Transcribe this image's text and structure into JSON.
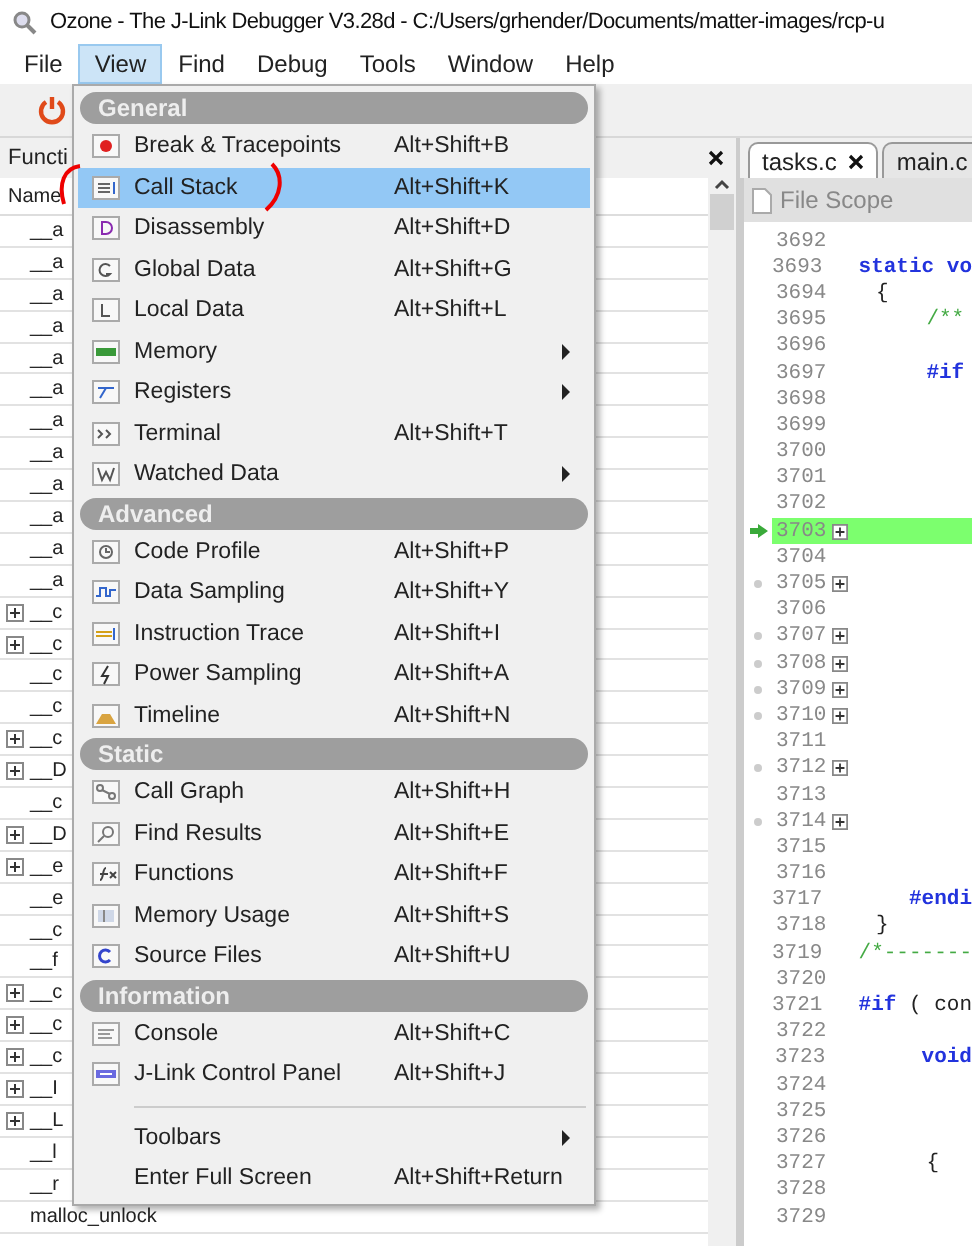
{
  "window": {
    "title": "Ozone - The J-Link Debugger V3.28d - C:/Users/grhender/Documents/matter-images/rcp-u"
  },
  "menubar": [
    {
      "label": "File",
      "selected": false
    },
    {
      "label": "View",
      "selected": true
    },
    {
      "label": "Find",
      "selected": false
    },
    {
      "label": "Debug",
      "selected": false
    },
    {
      "label": "Tools",
      "selected": false
    },
    {
      "label": "Window",
      "selected": false
    },
    {
      "label": "Help",
      "selected": false
    }
  ],
  "functions_panel": {
    "title": "Functi",
    "column": "Name",
    "rows": [
      {
        "name": "__a",
        "expandable": false
      },
      {
        "name": "__a",
        "expandable": false
      },
      {
        "name": "__a",
        "expandable": false
      },
      {
        "name": "__a",
        "expandable": false
      },
      {
        "name": "__a",
        "expandable": false
      },
      {
        "name": "__a",
        "expandable": false
      },
      {
        "name": "__a",
        "expandable": false
      },
      {
        "name": "__a",
        "expandable": false
      },
      {
        "name": "__a",
        "expandable": false
      },
      {
        "name": "__a",
        "expandable": false
      },
      {
        "name": "__a",
        "expandable": false
      },
      {
        "name": "__a",
        "expandable": false
      },
      {
        "name": "__c",
        "expandable": true
      },
      {
        "name": "__c",
        "expandable": true
      },
      {
        "name": "__c",
        "expandable": false
      },
      {
        "name": "__c",
        "expandable": false
      },
      {
        "name": "__c",
        "expandable": true
      },
      {
        "name": "__D",
        "expandable": true
      },
      {
        "name": "__c",
        "expandable": false
      },
      {
        "name": "__D",
        "expandable": true
      },
      {
        "name": "__e",
        "expandable": true
      },
      {
        "name": "__e",
        "expandable": false
      },
      {
        "name": "__c",
        "expandable": false
      },
      {
        "name": "__f",
        "expandable": false
      },
      {
        "name": "__c",
        "expandable": true
      },
      {
        "name": "__c",
        "expandable": true
      },
      {
        "name": "__c",
        "expandable": true
      },
      {
        "name": "__I",
        "expandable": true
      },
      {
        "name": "__L",
        "expandable": true
      },
      {
        "name": "__l",
        "expandable": false
      },
      {
        "name": "__r",
        "expandable": false
      },
      {
        "name": "malloc_unlock",
        "expandable": false
      }
    ]
  },
  "editor": {
    "tabs": [
      {
        "label": "tasks.c",
        "selected": true,
        "closable": true
      },
      {
        "label": "main.c",
        "selected": false,
        "closable": false
      }
    ],
    "scope": "File Scope",
    "lines": [
      {
        "number": "3692"
      },
      {
        "number": "3693",
        "code": [
          {
            "kind": "keyword",
            "text": "static vo"
          }
        ]
      },
      {
        "number": "3694",
        "code": [
          {
            "kind": "plain",
            "text": "{"
          }
        ]
      },
      {
        "number": "3695",
        "code": [
          {
            "kind": "comment",
            "text": "    /**"
          }
        ]
      },
      {
        "number": "3696"
      },
      {
        "number": "3697",
        "code": [
          {
            "kind": "keyword",
            "text": "    #if"
          }
        ]
      },
      {
        "number": "3698"
      },
      {
        "number": "3699"
      },
      {
        "number": "3700"
      },
      {
        "number": "3701"
      },
      {
        "number": "3702"
      },
      {
        "number": "3703",
        "current": true,
        "foldable": true
      },
      {
        "number": "3704"
      },
      {
        "number": "3705",
        "foldable": true,
        "breakpointable": true
      },
      {
        "number": "3706"
      },
      {
        "number": "3707",
        "foldable": true,
        "breakpointable": true
      },
      {
        "number": "3708",
        "foldable": true,
        "breakpointable": true
      },
      {
        "number": "3709",
        "foldable": true,
        "breakpointable": true
      },
      {
        "number": "3710",
        "foldable": true,
        "breakpointable": true
      },
      {
        "number": "3711"
      },
      {
        "number": "3712",
        "foldable": true,
        "breakpointable": true
      },
      {
        "number": "3713"
      },
      {
        "number": "3714",
        "foldable": true,
        "breakpointable": true
      },
      {
        "number": "3715"
      },
      {
        "number": "3716"
      },
      {
        "number": "3717",
        "code": [
          {
            "kind": "keyword",
            "text": "    #endi"
          }
        ]
      },
      {
        "number": "3718",
        "code": [
          {
            "kind": "plain",
            "text": "}"
          }
        ]
      },
      {
        "number": "3719",
        "code": [
          {
            "kind": "comment",
            "text": "/*-------"
          }
        ]
      },
      {
        "number": "3720"
      },
      {
        "number": "3721",
        "code": [
          {
            "kind": "keyword",
            "text": "#if"
          },
          {
            "kind": "plain",
            "text": " ( con"
          }
        ]
      },
      {
        "number": "3722"
      },
      {
        "number": "3723",
        "code": [
          {
            "kind": "keyword",
            "text": "    void"
          }
        ]
      },
      {
        "number": "3724"
      },
      {
        "number": "3725"
      },
      {
        "number": "3726"
      },
      {
        "number": "3727",
        "code": [
          {
            "kind": "plain",
            "text": "    {"
          }
        ]
      },
      {
        "number": "3728"
      },
      {
        "number": "3729"
      }
    ]
  },
  "view_menu": [
    {
      "kind": "section",
      "label": "General"
    },
    {
      "kind": "item",
      "label": "Break & Tracepoints",
      "shortcut": "Alt+Shift+B",
      "selected": false
    },
    {
      "kind": "item",
      "label": "Call Stack",
      "shortcut": "Alt+Shift+K",
      "selected": true
    },
    {
      "kind": "item",
      "label": "Disassembly",
      "shortcut": "Alt+Shift+D",
      "selected": false
    },
    {
      "kind": "item",
      "label": "Global Data",
      "shortcut": "Alt+Shift+G",
      "selected": false
    },
    {
      "kind": "item",
      "label": "Local Data",
      "shortcut": "Alt+Shift+L",
      "selected": false
    },
    {
      "kind": "submenu",
      "label": "Memory",
      "selected": false
    },
    {
      "kind": "submenu",
      "label": "Registers",
      "selected": false
    },
    {
      "kind": "item",
      "label": "Terminal",
      "shortcut": "Alt+Shift+T",
      "selected": false
    },
    {
      "kind": "submenu",
      "label": "Watched Data",
      "selected": false
    },
    {
      "kind": "section",
      "label": "Advanced"
    },
    {
      "kind": "item",
      "label": "Code Profile",
      "shortcut": "Alt+Shift+P",
      "selected": false
    },
    {
      "kind": "item",
      "label": "Data Sampling",
      "shortcut": "Alt+Shift+Y",
      "selected": false
    },
    {
      "kind": "item",
      "label": "Instruction Trace",
      "shortcut": "Alt+Shift+I",
      "selected": false
    },
    {
      "kind": "item",
      "label": "Power Sampling",
      "shortcut": "Alt+Shift+A",
      "selected": false
    },
    {
      "kind": "item",
      "label": "Timeline",
      "shortcut": "Alt+Shift+N",
      "selected": false
    },
    {
      "kind": "section",
      "label": "Static"
    },
    {
      "kind": "item",
      "label": "Call Graph",
      "shortcut": "Alt+Shift+H",
      "selected": false
    },
    {
      "kind": "item",
      "label": "Find Results",
      "shortcut": "Alt+Shift+E",
      "selected": false
    },
    {
      "kind": "item",
      "label": "Functions",
      "shortcut": "Alt+Shift+F",
      "selected": false
    },
    {
      "kind": "item",
      "label": "Memory Usage",
      "shortcut": "Alt+Shift+S",
      "selected": false
    },
    {
      "kind": "item",
      "label": "Source Files",
      "shortcut": "Alt+Shift+U",
      "selected": false
    },
    {
      "kind": "section",
      "label": "Information"
    },
    {
      "kind": "item",
      "label": "Console",
      "shortcut": "Alt+Shift+C",
      "selected": false
    },
    {
      "kind": "item",
      "label": "J-Link Control Panel",
      "shortcut": "Alt+Shift+J",
      "selected": false
    },
    {
      "kind": "separator"
    },
    {
      "kind": "submenu",
      "label": "Toolbars",
      "selected": false
    },
    {
      "kind": "item",
      "label": "Enter Full Screen",
      "shortcut": "Alt+Shift+Return",
      "selected": false
    }
  ]
}
